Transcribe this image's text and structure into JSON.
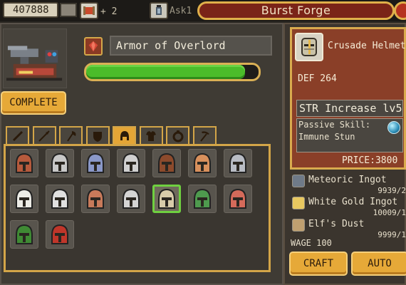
{
  "topbar": {
    "gold": "407888",
    "item_count": "+ 2",
    "truncated_text": "Ask1"
  },
  "title": "Burst Forge",
  "forge": {
    "item_name": "Armor of Overlord",
    "progress_fraction": 0.92,
    "complete_label": "COMPLETE"
  },
  "tabs": [
    {
      "icon": "sword-icon",
      "active": false
    },
    {
      "icon": "spear-icon",
      "active": false
    },
    {
      "icon": "axe-icon",
      "active": false
    },
    {
      "icon": "shield-icon",
      "active": false
    },
    {
      "icon": "helmet-icon",
      "active": true
    },
    {
      "icon": "armor-icon",
      "active": false
    },
    {
      "icon": "ring-icon",
      "active": false
    },
    {
      "icon": "pickaxe-icon",
      "active": false
    }
  ],
  "helmets": [
    {
      "icon": "hood-helmet-icon",
      "color": "#b65a3c",
      "selected": false
    },
    {
      "icon": "iron-helmet-icon",
      "color": "#c8c8c8",
      "selected": false
    },
    {
      "icon": "plumed-helmet-icon",
      "color": "#8a98c8",
      "selected": false
    },
    {
      "icon": "skull-cap-icon",
      "color": "#d0d0d0",
      "selected": false
    },
    {
      "icon": "witch-hat-icon",
      "color": "#8c4a2c",
      "selected": false
    },
    {
      "icon": "bronze-mask-icon",
      "color": "#d8905c",
      "selected": false
    },
    {
      "icon": "steel-helm-icon",
      "color": "#b8bcc4",
      "selected": false
    },
    {
      "icon": "white-hood-icon",
      "color": "#ecece6",
      "selected": false
    },
    {
      "icon": "skull-helm-icon",
      "color": "#e0e0e0",
      "selected": false
    },
    {
      "icon": "copper-helm-icon",
      "color": "#c87a5a",
      "selected": false
    },
    {
      "icon": "knight-helm-icon",
      "color": "#d4d4d4",
      "selected": false
    },
    {
      "icon": "crusade-helmet-icon",
      "color": "#d8ccaa",
      "selected": true
    },
    {
      "icon": "spiked-green-helm-icon",
      "color": "#4e9a4e",
      "selected": false
    },
    {
      "icon": "horned-helm-icon",
      "color": "#d46a5a",
      "selected": false
    },
    {
      "icon": "jade-helm-icon",
      "color": "#3f8a34",
      "selected": false
    },
    {
      "icon": "demon-helm-icon",
      "color": "#c0362a",
      "selected": false
    }
  ],
  "detail": {
    "name": "Crusade Helmet",
    "def": "DEF 264",
    "skill": "STR Increase lv5",
    "passive_line1": "Passive Skill:",
    "passive_line2": "Immune Stun",
    "price": "PRICE:3800"
  },
  "materials": [
    {
      "name": "Meteoric Ingot",
      "count": "9939/2",
      "icon": "meteoric-ingot-icon",
      "color": "#6f7a88"
    },
    {
      "name": "White Gold Ingot",
      "count": "10009/1",
      "icon": "white-gold-ingot-icon",
      "color": "#e8c860"
    },
    {
      "name": "Elf's Dust",
      "count": "9999/1",
      "icon": "elf-dust-icon",
      "color": "#c0a070"
    }
  ],
  "wage": "WAGE 100",
  "buttons": {
    "craft": "CRAFT",
    "auto": "AUTO"
  }
}
